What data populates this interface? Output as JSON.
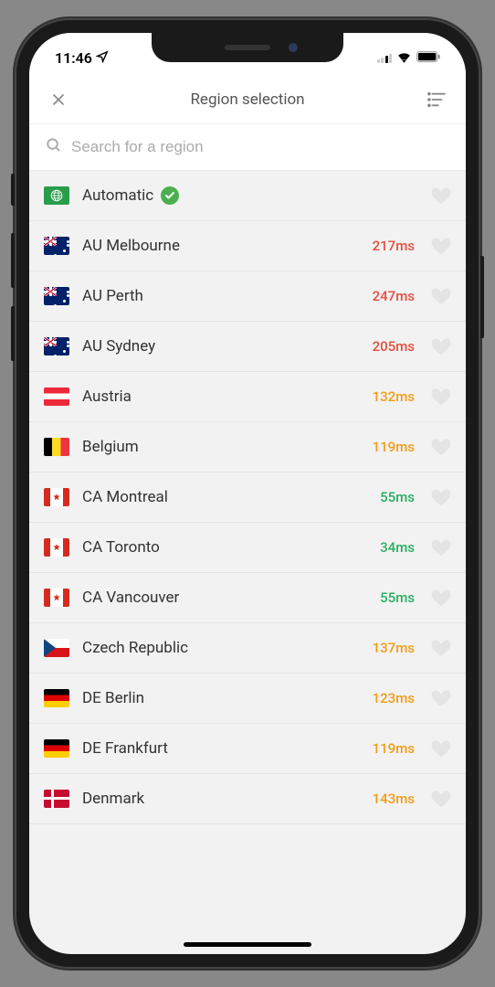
{
  "status": {
    "time": "11:46"
  },
  "header": {
    "title": "Region selection"
  },
  "search": {
    "placeholder": "Search for a region"
  },
  "regions": [
    {
      "id": "automatic",
      "name": "Automatic",
      "flag": "auto",
      "latency": "",
      "latencyClass": "",
      "selected": true
    },
    {
      "id": "au-melbourne",
      "name": "AU Melbourne",
      "flag": "au",
      "latency": "217ms",
      "latencyClass": "red",
      "selected": false
    },
    {
      "id": "au-perth",
      "name": "AU Perth",
      "flag": "au",
      "latency": "247ms",
      "latencyClass": "red",
      "selected": false
    },
    {
      "id": "au-sydney",
      "name": "AU Sydney",
      "flag": "au",
      "latency": "205ms",
      "latencyClass": "red",
      "selected": false
    },
    {
      "id": "austria",
      "name": "Austria",
      "flag": "at",
      "latency": "132ms",
      "latencyClass": "orange",
      "selected": false
    },
    {
      "id": "belgium",
      "name": "Belgium",
      "flag": "be",
      "latency": "119ms",
      "latencyClass": "orange",
      "selected": false
    },
    {
      "id": "ca-montreal",
      "name": "CA Montreal",
      "flag": "ca",
      "latency": "55ms",
      "latencyClass": "green",
      "selected": false
    },
    {
      "id": "ca-toronto",
      "name": "CA Toronto",
      "flag": "ca",
      "latency": "34ms",
      "latencyClass": "green",
      "selected": false
    },
    {
      "id": "ca-vancouver",
      "name": "CA Vancouver",
      "flag": "ca",
      "latency": "55ms",
      "latencyClass": "green",
      "selected": false
    },
    {
      "id": "czech",
      "name": "Czech Republic",
      "flag": "cz",
      "latency": "137ms",
      "latencyClass": "orange",
      "selected": false
    },
    {
      "id": "de-berlin",
      "name": "DE Berlin",
      "flag": "de",
      "latency": "123ms",
      "latencyClass": "orange",
      "selected": false
    },
    {
      "id": "de-frankfurt",
      "name": "DE Frankfurt",
      "flag": "de",
      "latency": "119ms",
      "latencyClass": "orange",
      "selected": false
    },
    {
      "id": "denmark",
      "name": "Denmark",
      "flag": "dk",
      "latency": "143ms",
      "latencyClass": "orange",
      "selected": false
    }
  ]
}
